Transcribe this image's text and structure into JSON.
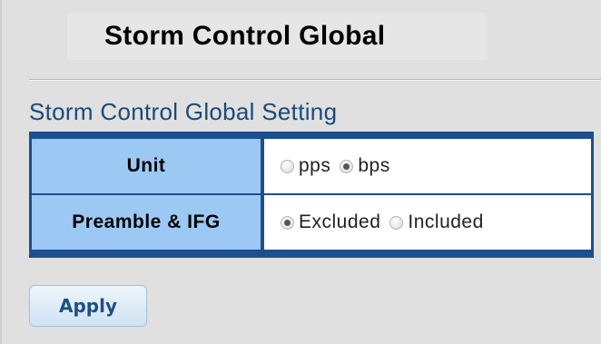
{
  "page": {
    "title": "Storm Control Global"
  },
  "section": {
    "title": "Storm Control Global Setting"
  },
  "settings": {
    "unit": {
      "label": "Unit",
      "options": [
        "pps",
        "bps"
      ],
      "selected": "bps"
    },
    "preamble_ifg": {
      "label": "Preamble & IFG",
      "options": [
        "Excluded",
        "Included"
      ],
      "selected": "Excluded"
    }
  },
  "actions": {
    "apply_label": "Apply"
  },
  "colors": {
    "table_border": "#1c4f8c",
    "label_bg": "#9cc8f4",
    "section_title": "#1a4a7a",
    "button_text": "#1d4f86"
  },
  "icons": {
    "radio_unselected": "radio-unselected-icon",
    "radio_selected": "radio-selected-icon"
  }
}
